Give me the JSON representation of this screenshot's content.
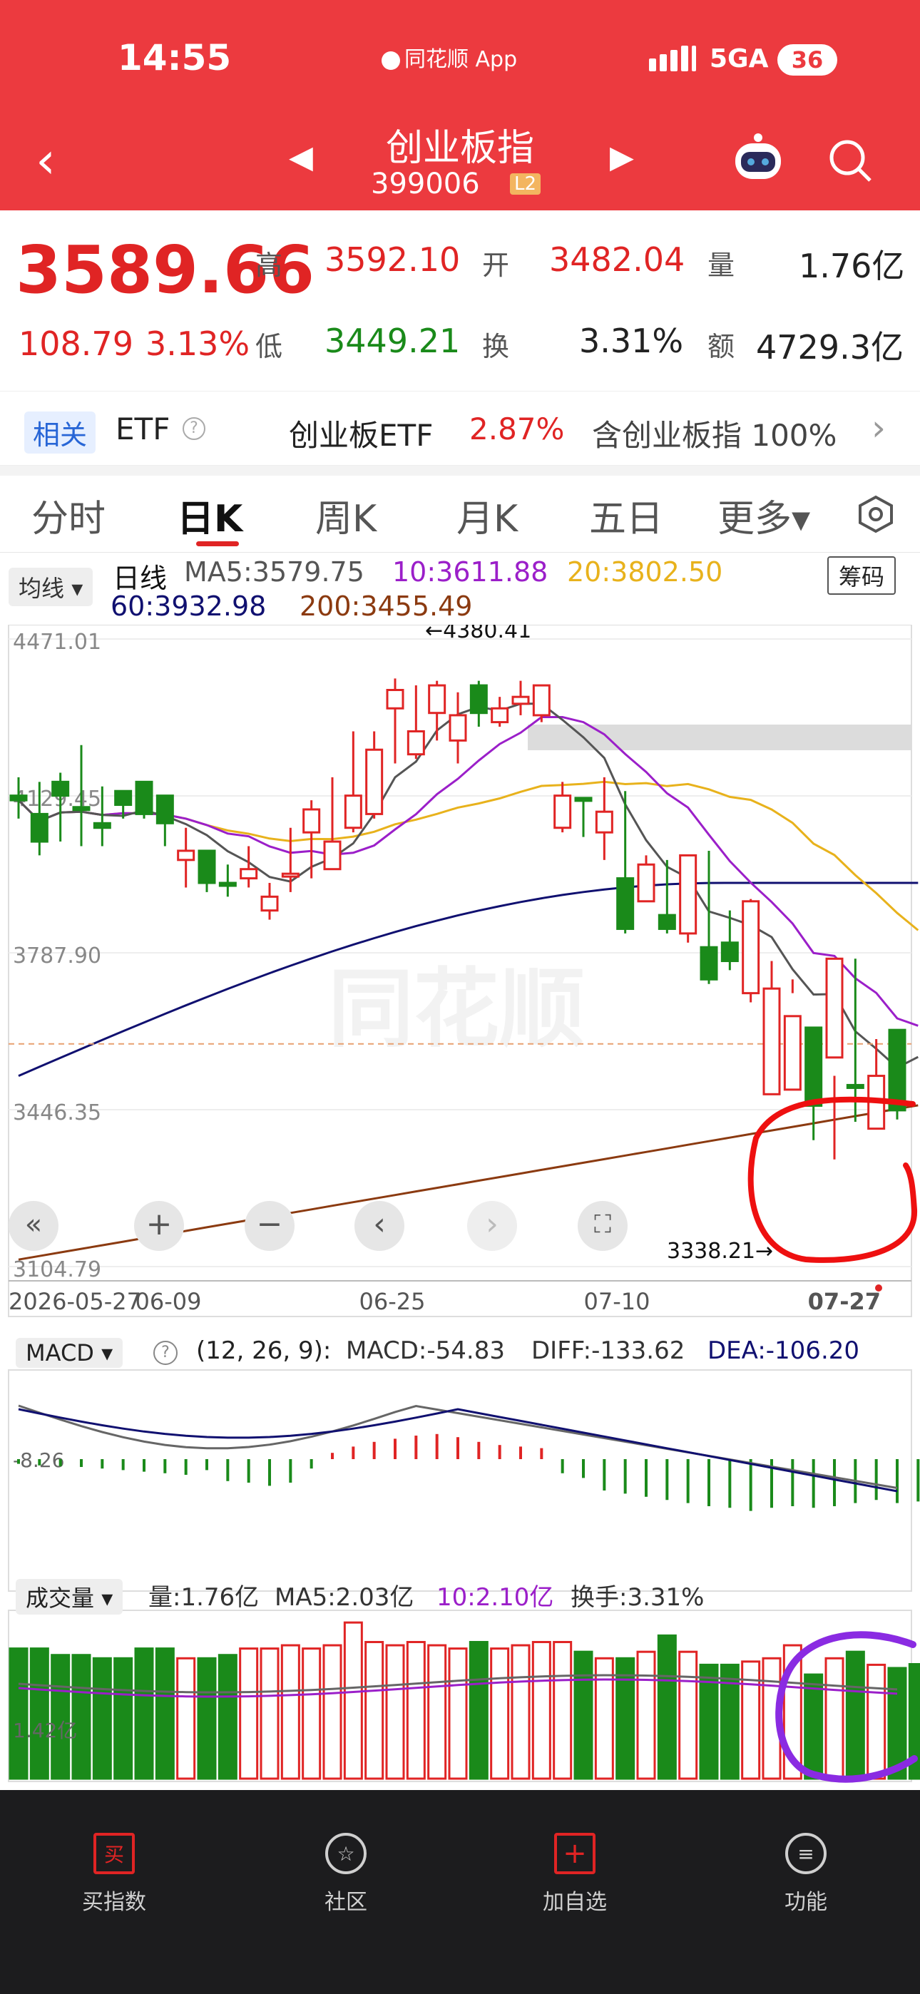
{
  "status_bar": {
    "time": "14:55",
    "center_label": "同花顺 App",
    "network": "5GA",
    "battery": "36"
  },
  "header": {
    "title": "创业板指",
    "code": "399006",
    "level_badge": "L2"
  },
  "quote": {
    "price": "3589.66",
    "change": "108.79",
    "change_pct": "3.13%",
    "high_label": "高",
    "high": "3592.10",
    "open_label": "开",
    "open": "3482.04",
    "volume_label": "量",
    "volume": "1.76亿",
    "low_label": "低",
    "low": "3449.21",
    "turnover_label": "换",
    "turnover": "3.31%",
    "amount_label": "额",
    "amount": "4729.3亿"
  },
  "etf": {
    "tag": "相关",
    "label": "ETF",
    "name": "创业板ETF",
    "pct": "2.87%",
    "contains": "含创业板指 100%"
  },
  "tabs": [
    {
      "label": "分时"
    },
    {
      "label": "日K"
    },
    {
      "label": "周K"
    },
    {
      "label": "月K"
    },
    {
      "label": "五日"
    },
    {
      "label": "更多▾"
    }
  ],
  "kline": {
    "indicator_select": "均线",
    "period_label": "日线",
    "ma5": "MA5:3579.75",
    "ma10": "10:3611.88",
    "ma20": "20:3802.50",
    "ma60": "60:3932.98",
    "ma200": "200:3455.49",
    "chip_button": "筹码",
    "price_ticks": [
      "4471.01",
      "4129.45",
      "3787.90",
      "3446.35",
      "3104.79"
    ],
    "high_annot": "←4380.41",
    "low_annot": "3338.21→",
    "date_ticks": [
      "2026-05-27",
      "06-09",
      "06-25",
      "07-10",
      "07-27"
    ],
    "colors": {
      "up": "#e02424",
      "down": "#1a8a1a",
      "ma5": "#555555",
      "ma10": "#9b1fc9",
      "ma20": "#e8b21c",
      "ma60": "#101070",
      "ma200": "#8b3a10"
    }
  },
  "macd": {
    "select": "MACD",
    "params": "(12, 26, 9):",
    "macd": "MACD:-54.83",
    "diff": "DIFF:-133.62",
    "dea": "DEA:-106.20",
    "axis_label": "-8.26"
  },
  "volume": {
    "select": "成交量",
    "vol": "量:1.76亿",
    "ma5": "MA5:2.03亿",
    "ma10": "10:2.10亿",
    "turn": "换手:3.31%",
    "axis_label": "1.42亿"
  },
  "bottom_nav": [
    {
      "label": "买指数",
      "icon": "buy-icon",
      "glyph": "买"
    },
    {
      "label": "社区",
      "icon": "community-star-icon",
      "glyph": "☆"
    },
    {
      "label": "加自选",
      "icon": "add-favorite-icon",
      "glyph": "+"
    },
    {
      "label": "功能",
      "icon": "menu-icon",
      "glyph": "≡"
    }
  ],
  "chart_data": {
    "type": "candlestick",
    "x": [
      "2026-05-27",
      "05-28",
      "05-29",
      "06-01",
      "06-02",
      "06-03",
      "06-04",
      "06-05",
      "06-08",
      "06-09",
      "06-10",
      "06-11",
      "06-12",
      "06-15",
      "06-16",
      "06-17",
      "06-18",
      "06-19",
      "06-22",
      "06-23",
      "06-24",
      "06-25",
      "06-26",
      "06-29",
      "06-30",
      "07-01",
      "07-02",
      "07-03",
      "07-06",
      "07-07",
      "07-08",
      "07-09",
      "07-10",
      "07-13",
      "07-14",
      "07-15",
      "07-16",
      "07-17",
      "07-20",
      "07-21",
      "07-22",
      "07-23",
      "07-24",
      "07-27"
    ],
    "open": [
      4130,
      4090,
      4160,
      4105,
      4070,
      4140,
      4160,
      4130,
      3990,
      4010,
      3940,
      3950,
      3880,
      3960,
      4050,
      3970,
      4060,
      4090,
      4320,
      4220,
      4310,
      4250,
      4370,
      4290,
      4330,
      4305,
      4060,
      4125,
      4050,
      3950,
      3900,
      3870,
      3830,
      3800,
      3810,
      3700,
      3480,
      3490,
      3625,
      3560,
      3500,
      3405,
      3620
    ],
    "close": [
      4120,
      4030,
      4130,
      4100,
      4060,
      4110,
      4090,
      4070,
      4010,
      3940,
      3935,
      3970,
      3910,
      3960,
      4100,
      4030,
      4130,
      4230,
      4360,
      4270,
      4370,
      4305,
      4310,
      4320,
      4345,
      4370,
      4130,
      4120,
      4095,
      3840,
      3980,
      3840,
      4000,
      3730,
      3770,
      3900,
      3710,
      3650,
      3455,
      3775,
      3495,
      3520,
      3445,
      3570
    ],
    "high": [
      4170,
      4160,
      4180,
      4240,
      4150,
      4130,
      4160,
      4110,
      4060,
      4010,
      3980,
      4020,
      3940,
      4060,
      4120,
      4170,
      4270,
      4270,
      4385,
      4370,
      4380,
      4355,
      4380,
      4345,
      4380,
      4330,
      4160,
      4120,
      4170,
      4140,
      4000,
      3990,
      4000,
      4010,
      3880,
      3905,
      3770,
      3730,
      3490,
      3520,
      3775,
      3600,
      3535,
      3590
    ],
    "low": [
      4080,
      4000,
      4030,
      4020,
      4020,
      4080,
      4080,
      4020,
      3930,
      3920,
      3910,
      3930,
      3860,
      3920,
      3950,
      4000,
      4050,
      4080,
      4200,
      4210,
      4250,
      4200,
      4280,
      4280,
      4305,
      4290,
      4050,
      4040,
      3990,
      3830,
      3920,
      3830,
      3810,
      3720,
      3750,
      3680,
      3680,
      3700,
      3380,
      3338,
      3420,
      3470,
      3425,
      3500
    ],
    "ylim": [
      3104.79,
      4471.01
    ]
  }
}
